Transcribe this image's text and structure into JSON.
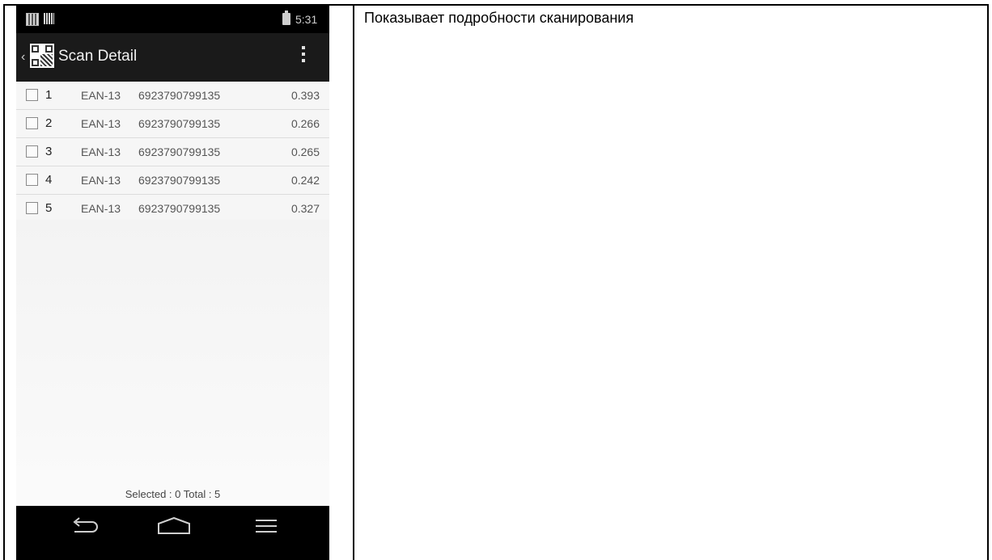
{
  "status_bar": {
    "time": "5:31"
  },
  "app_bar": {
    "title": "Scan Detail"
  },
  "rows": [
    {
      "index": "1",
      "type": "EAN-13",
      "code": "6923790799135",
      "time": "0.393"
    },
    {
      "index": "2",
      "type": "EAN-13",
      "code": "6923790799135",
      "time": "0.266"
    },
    {
      "index": "3",
      "type": "EAN-13",
      "code": "6923790799135",
      "time": "0.265"
    },
    {
      "index": "4",
      "type": "EAN-13",
      "code": "6923790799135",
      "time": "0.242"
    },
    {
      "index": "5",
      "type": "EAN-13",
      "code": "6923790799135",
      "time": "0.327"
    }
  ],
  "summary": "Selected : 0   Total : 5",
  "caption": "Показывает подробности сканирования",
  "icons": [
    "barcode-notification-icon",
    "signal-icon",
    "battery-icon",
    "back-chevron-icon",
    "qr-code-logo-icon",
    "overflow-menu-icon",
    "nav-back-icon",
    "nav-home-icon",
    "nav-menu-icon"
  ]
}
